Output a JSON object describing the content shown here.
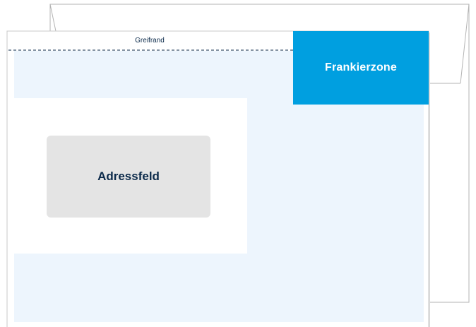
{
  "diagram": {
    "greifrand_label": "Greifrand",
    "frankierzone_label": "Frankierzone",
    "adressfeld_label": "Adressfeld"
  },
  "colors": {
    "frankierzone": "#009fe0",
    "background_zone": "#edf5fd",
    "address_field": "#e4e4e4",
    "text_dark": "#0b2a4a",
    "envelope_border": "#b3b3b3"
  }
}
